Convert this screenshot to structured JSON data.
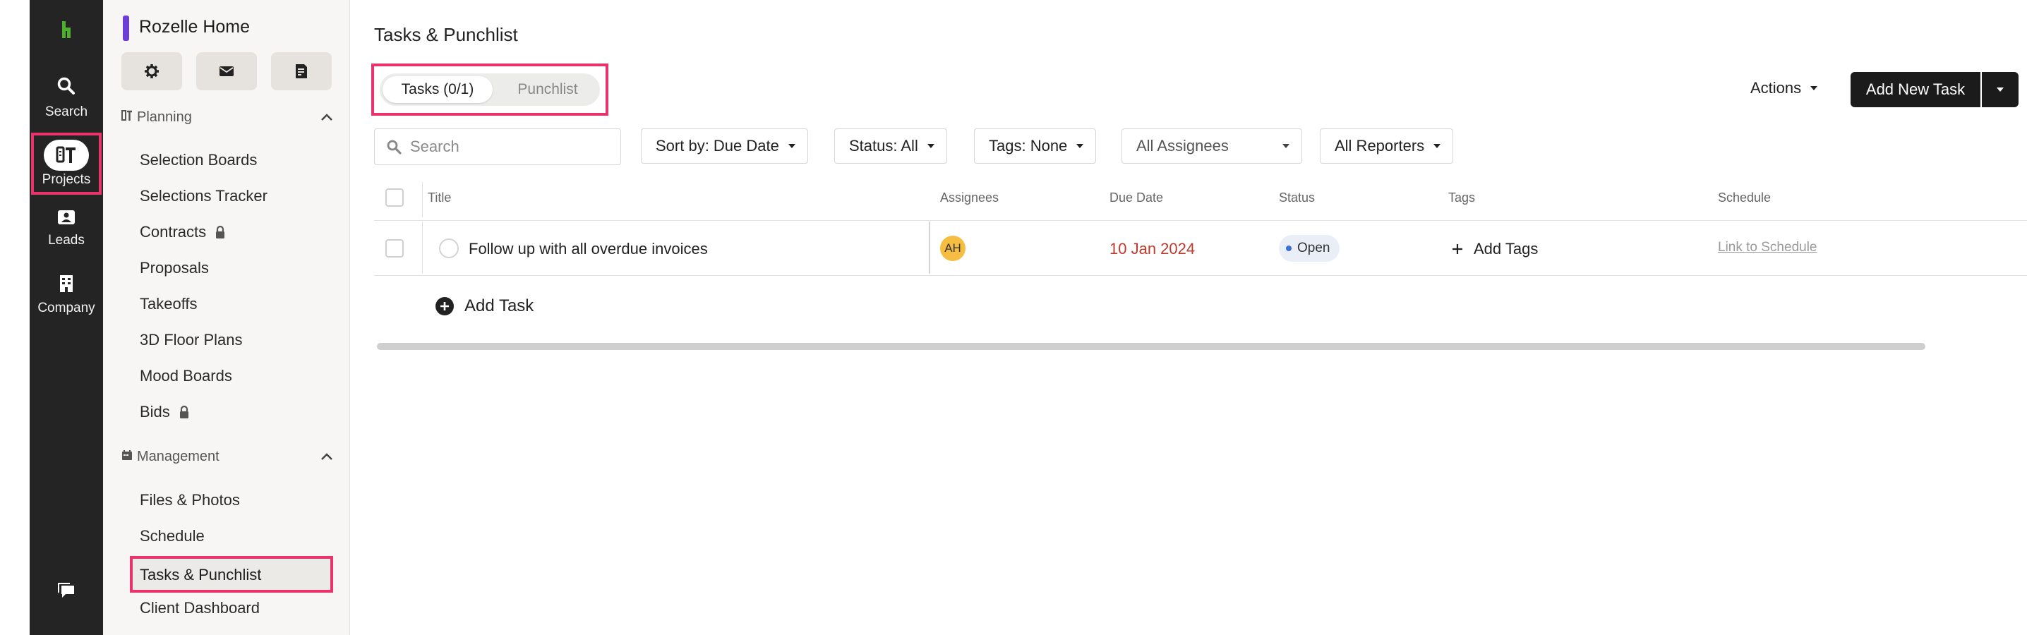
{
  "rail": {
    "search_label": "Search",
    "projects_label": "Projects",
    "leads_label": "Leads",
    "company_label": "Company"
  },
  "colors": {
    "brand_green": "#4caf2e",
    "highlight": "#e8336d",
    "project_accent": "#6b3fd6"
  },
  "sidebar": {
    "project_name": "Rozelle Home",
    "quick_actions": [
      "gear-icon",
      "mail-icon",
      "receipt-icon"
    ],
    "planning": {
      "title": "Planning",
      "items": [
        {
          "label": "Selection Boards",
          "locked": false
        },
        {
          "label": "Selections Tracker",
          "locked": false
        },
        {
          "label": "Contracts",
          "locked": true
        },
        {
          "label": "Proposals",
          "locked": false
        },
        {
          "label": "Takeoffs",
          "locked": false
        },
        {
          "label": "3D Floor Plans",
          "locked": false
        },
        {
          "label": "Mood Boards",
          "locked": false
        },
        {
          "label": "Bids",
          "locked": true
        }
      ]
    },
    "management": {
      "title": "Management",
      "items": [
        {
          "label": "Files & Photos"
        },
        {
          "label": "Schedule"
        },
        {
          "label": "Tasks & Punchlist",
          "active": true
        },
        {
          "label": "Client Dashboard"
        }
      ]
    }
  },
  "main": {
    "title": "Tasks & Punchlist",
    "tabs": [
      {
        "label": "Tasks (0/1)",
        "active": true
      },
      {
        "label": "Punchlist",
        "active": false
      }
    ],
    "actions_label": "Actions",
    "add_task_label": "Add New Task",
    "search_placeholder": "Search",
    "filters": {
      "sort": "Sort by: Due Date",
      "status": "Status: All",
      "tags": "Tags: None",
      "assignees": "All Assignees",
      "reporters": "All Reporters"
    },
    "columns": [
      "Title",
      "Assignees",
      "Due Date",
      "Status",
      "Tags",
      "Schedule"
    ],
    "rows": [
      {
        "title": "Follow up with all overdue invoices",
        "assignee_initials": "AH",
        "due_date": "10 Jan 2024",
        "status": "Open",
        "tags_action": "Add Tags",
        "schedule_link": "Link to Schedule"
      }
    ],
    "add_row_label": "Add Task"
  }
}
